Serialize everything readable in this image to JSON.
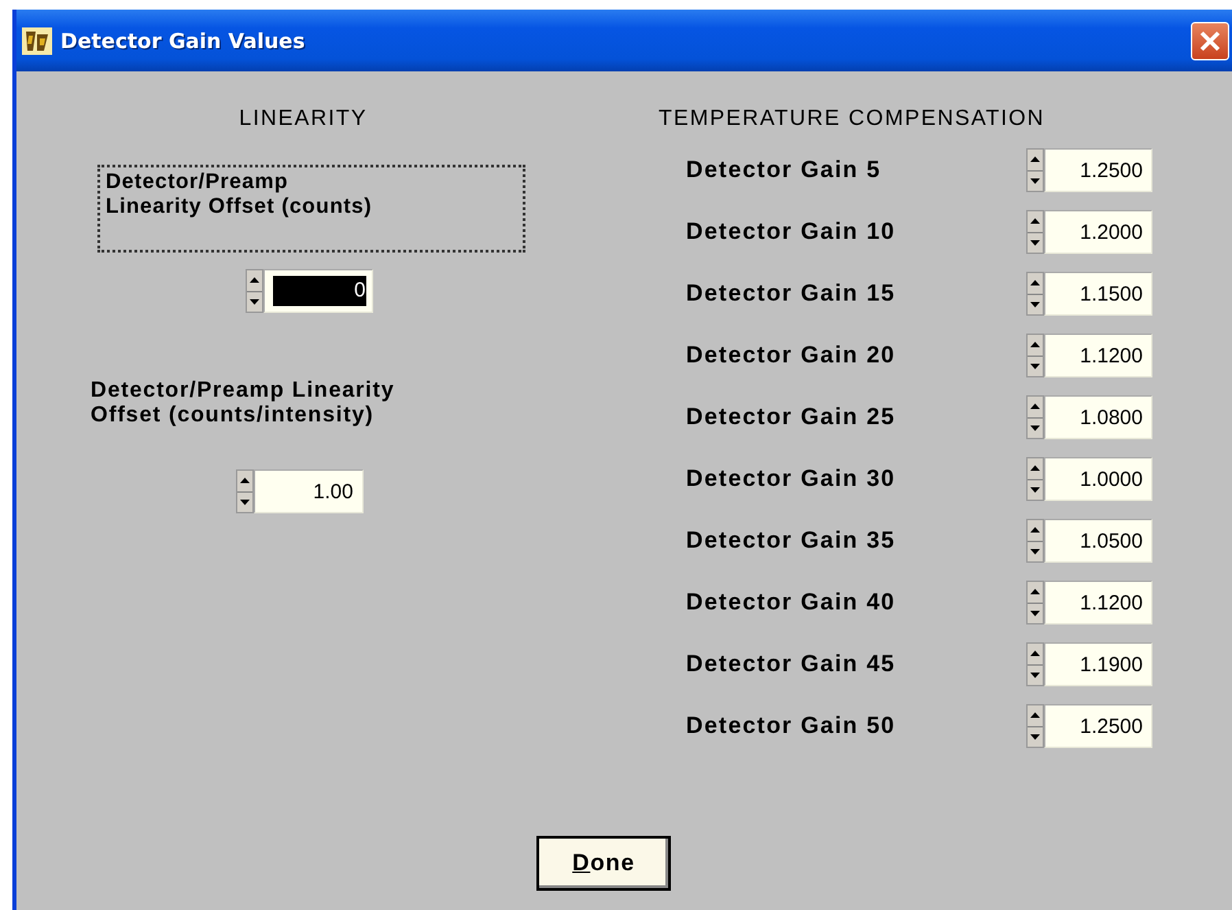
{
  "window": {
    "title": "Detector Gain Values"
  },
  "linearity": {
    "heading": "LINEARITY",
    "controls": [
      {
        "label": "Detector/Preamp Linearity Offset (counts)",
        "focused": true,
        "value": "0",
        "selected": true
      },
      {
        "label": "Detector/Preamp Linearity Offset (counts/intensity)",
        "focused": false,
        "value": "1.00",
        "selected": false
      }
    ]
  },
  "temperature_compensation": {
    "heading": "TEMPERATURE COMPENSATION",
    "rows": [
      {
        "label": "Detector Gain 5",
        "value": "1.2500"
      },
      {
        "label": "Detector Gain 10",
        "value": "1.2000"
      },
      {
        "label": "Detector Gain 15",
        "value": "1.1500"
      },
      {
        "label": "Detector Gain 20",
        "value": "1.1200"
      },
      {
        "label": "Detector Gain 25",
        "value": "1.0800"
      },
      {
        "label": "Detector Gain 30",
        "value": "1.0000"
      },
      {
        "label": "Detector Gain 35",
        "value": "1.0500"
      },
      {
        "label": "Detector Gain 40",
        "value": "1.1200"
      },
      {
        "label": "Detector Gain 45",
        "value": "1.1900"
      },
      {
        "label": "Detector Gain 50",
        "value": "1.2500"
      }
    ]
  },
  "buttons": [
    {
      "label": "Done"
    }
  ]
}
